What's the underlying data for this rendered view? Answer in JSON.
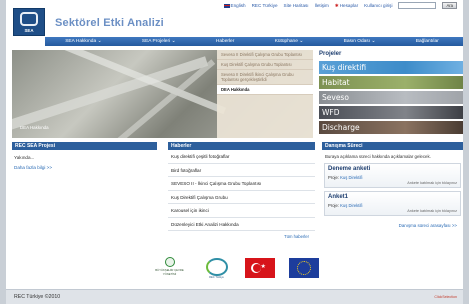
{
  "topbar": {
    "english": "English",
    "rec_turkey": "REC Türkiye",
    "sitemap": "Site Haritası",
    "contact": "İletişim",
    "hesaplar": "Hesaplar",
    "login": "Kullanıcı girişi",
    "search_button": "Ara"
  },
  "header": {
    "logo_text": "SEA",
    "title": "Sektörel Etki Analizi"
  },
  "nav": {
    "items": [
      "SEA Hakkında ⌄",
      "SEA Projeleri ⌄",
      "Haberler",
      "Kütüphane ⌄",
      "Basın Odası ⌄",
      "Bağlantılar"
    ]
  },
  "hero": {
    "caption": "DEA Hakkında",
    "list": [
      "Seveso II Direktifi Çalışma Grubu Toplantısı",
      "Kuş Direktifi Çalışma Grubu Toplantısı",
      "Seveso II Direktifi İkinci Çalışma Grubu Toplantısı gerçekleştirildi",
      "DEA Hakkında"
    ]
  },
  "projects": {
    "title": "Projeler",
    "items": [
      "Kuş direktifi",
      "Habitat",
      "Seveso",
      "WFD",
      "Discharge"
    ]
  },
  "col1": {
    "title": "REC SEA Projesi",
    "text": "Yakında...",
    "link": "Daha fazla bilgi >>"
  },
  "col2": {
    "title": "Haberler",
    "items": [
      "Kuş direktifi çeşitli fotoğraflar",
      "Bird fotoğraflar",
      "SEVESO II - İkinci Çalışma Grubu Toplantısı",
      "Kuş Direktifi Çalışma Grubu",
      "Karousel için ikinci",
      "Düzenleyici Etki Analizi Hakkında"
    ],
    "more": "Tüm haberler"
  },
  "col3": {
    "title": "Danışma Süreci",
    "intro": "Buraya açıklama süreci hakkında açıklamalar gelecek.",
    "surveys": [
      {
        "title": "Deneme anketi",
        "proj_label": "Proje:",
        "proj": "Kuş Direktifi",
        "note": "Ankete katılmak için tıklayınız"
      },
      {
        "title": "Anket1",
        "proj_label": "Proje:",
        "proj": "Kuş Direktifi",
        "note": "Ankete katılmak için tıklayınız"
      }
    ],
    "link": "Danışma süreci arasayfası >>"
  },
  "logos": {
    "cevre": "BÜYÜKŞEHİR ÇEVRE YÖNETİMİ",
    "green": "REC Türkiye"
  },
  "footer": {
    "left": "REC Türkiye ©2010",
    "right": "ClickSelection"
  }
}
